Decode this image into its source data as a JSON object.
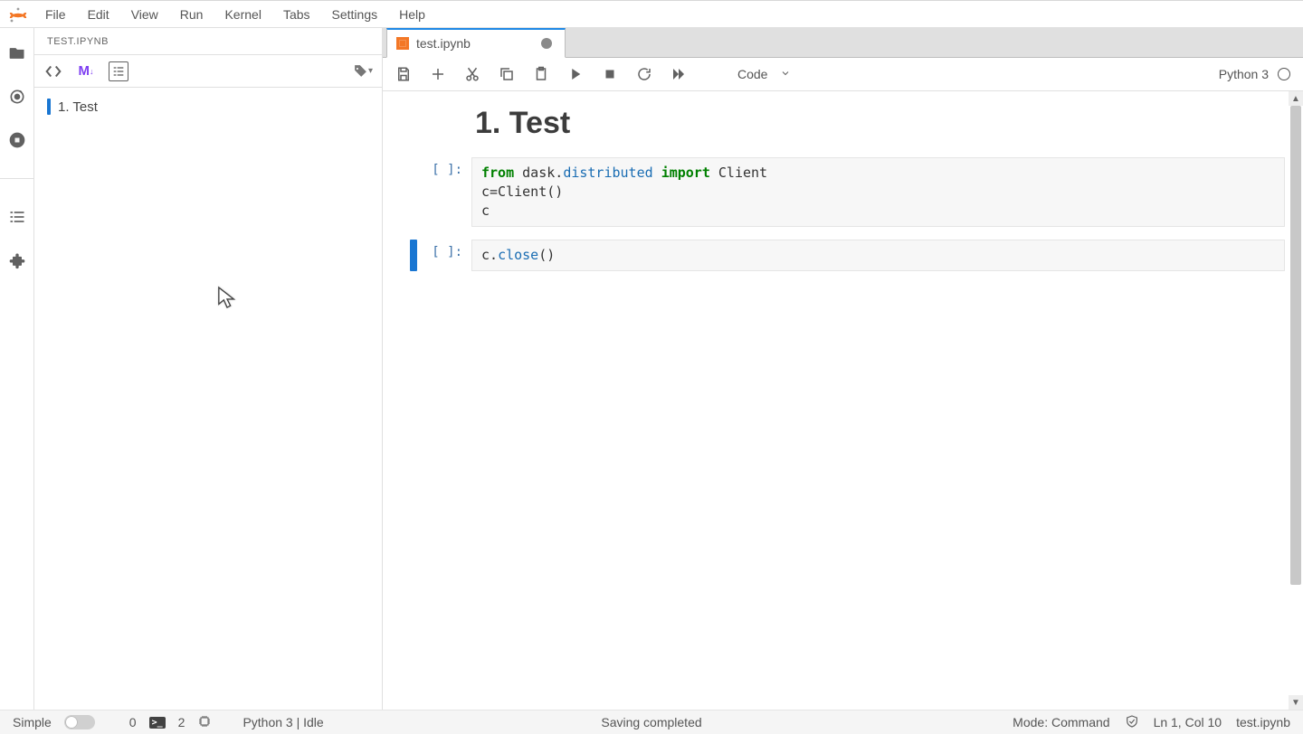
{
  "menubar": {
    "items": [
      "File",
      "Edit",
      "View",
      "Run",
      "Kernel",
      "Tabs",
      "Settings",
      "Help"
    ]
  },
  "sidepanel": {
    "title": "TEST.IPYNB",
    "toc": {
      "items": [
        "1. Test"
      ]
    }
  },
  "tab": {
    "label": "test.ipynb"
  },
  "toolbar": {
    "celltype": "Code",
    "kernel": "Python 3"
  },
  "notebook": {
    "heading": "1. Test",
    "cells": [
      {
        "prompt": "[ ]:",
        "code_tokens": [
          {
            "t": "from",
            "c": "kw"
          },
          {
            "t": " dask.",
            "c": ""
          },
          {
            "t": "distributed",
            "c": "mod"
          },
          {
            "t": " ",
            "c": ""
          },
          {
            "t": "import",
            "c": "kw"
          },
          {
            "t": " Client",
            "c": ""
          },
          {
            "t": "\n",
            "c": ""
          },
          {
            "t": "c",
            "c": ""
          },
          {
            "t": "=",
            "c": "op"
          },
          {
            "t": "Client()",
            "c": ""
          },
          {
            "t": "\n",
            "c": ""
          },
          {
            "t": "c",
            "c": ""
          }
        ],
        "code_plain": "from dask.distributed import Client\nc=Client()\nc"
      },
      {
        "prompt": "[ ]:",
        "selected": true,
        "code_tokens": [
          {
            "t": "c.",
            "c": ""
          },
          {
            "t": "close",
            "c": "attr"
          },
          {
            "t": "()",
            "c": ""
          }
        ],
        "code_plain": "c.close()"
      }
    ]
  },
  "statusbar": {
    "simple_label": "Simple",
    "count0": "0",
    "count2": "2",
    "kernel_status": "Python 3 | Idle",
    "center": "Saving completed",
    "mode": "Mode: Command",
    "cursor": "Ln 1, Col 10",
    "filename": "test.ipynb"
  }
}
